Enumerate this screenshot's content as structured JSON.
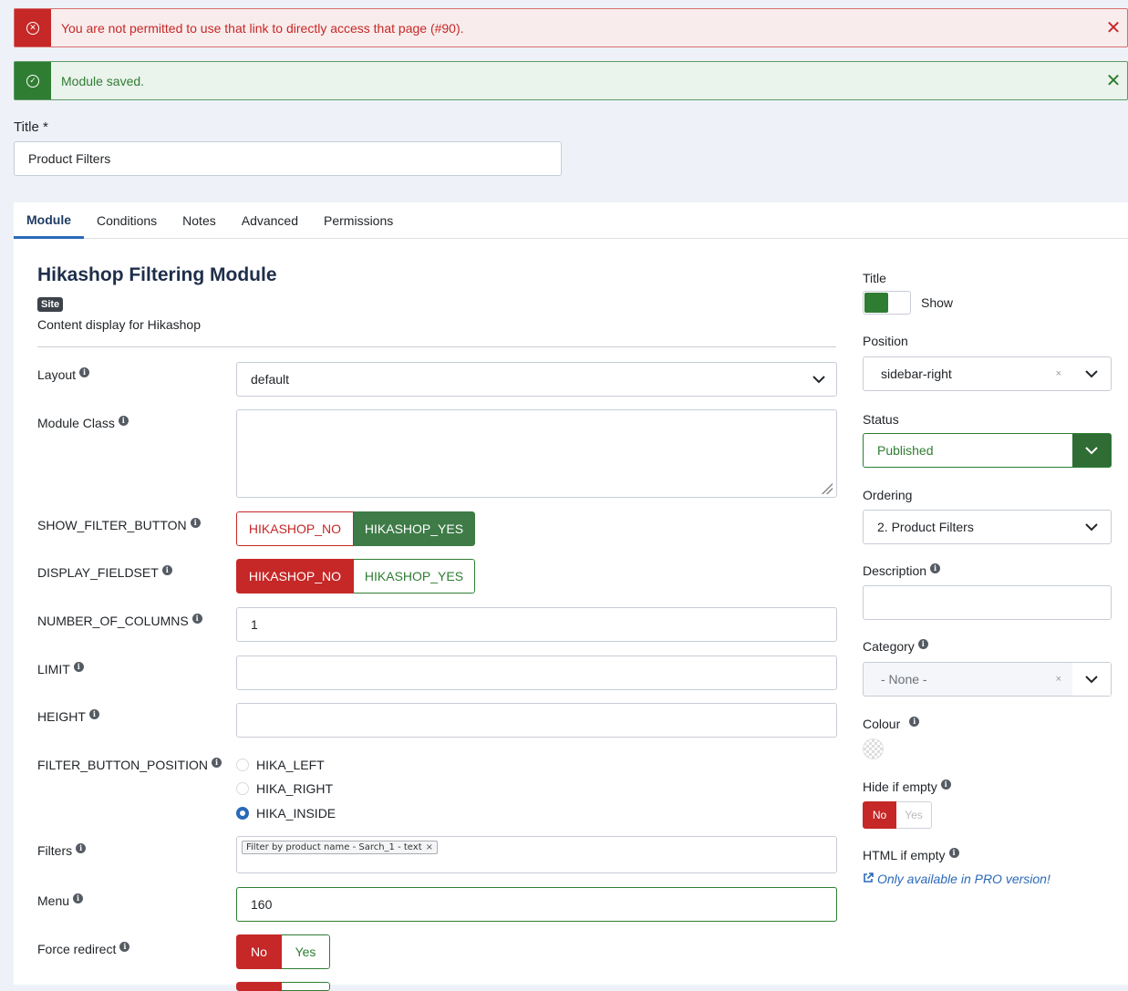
{
  "alerts": {
    "error": {
      "message": "You are not permitted to use that link to directly access that page (#90).",
      "icon": "x-circle-icon",
      "close": "✕"
    },
    "success": {
      "message": "Module saved.",
      "icon": "check-circle-icon",
      "close": "✕"
    }
  },
  "title_field": {
    "label": "Title *",
    "value": "Product Filters"
  },
  "tabs": [
    "Module",
    "Conditions",
    "Notes",
    "Advanced",
    "Permissions"
  ],
  "active_tab": "Module",
  "module": {
    "name": "Hikashop Filtering Module",
    "badge": "Site",
    "description": "Content display for Hikashop"
  },
  "form": {
    "layout": {
      "label": "Layout",
      "value": "default"
    },
    "module_class": {
      "label": "Module Class",
      "value": ""
    },
    "show_filter_button": {
      "label": "SHOW_FILTER_BUTTON",
      "no": "HIKASHOP_NO",
      "yes": "HIKASHOP_YES",
      "selected": "yes"
    },
    "display_fieldset": {
      "label": "DISPLAY_FIELDSET",
      "no": "HIKASHOP_NO",
      "yes": "HIKASHOP_YES",
      "selected": "no"
    },
    "number_of_columns": {
      "label": "NUMBER_OF_COLUMNS",
      "value": "1"
    },
    "limit": {
      "label": "LIMIT",
      "value": ""
    },
    "height": {
      "label": "HEIGHT",
      "value": ""
    },
    "filter_button_position": {
      "label": "FILTER_BUTTON_POSITION",
      "options": [
        "HIKA_LEFT",
        "HIKA_RIGHT",
        "HIKA_INSIDE"
      ],
      "selected": "HIKA_INSIDE"
    },
    "filters": {
      "label": "Filters",
      "chip": "Filter by product name - Sarch_1 - text",
      "chip_remove": "×"
    },
    "menu": {
      "label": "Menu",
      "value": "160"
    },
    "force_redirect": {
      "label": "Force redirect",
      "no": "No",
      "yes": "Yes",
      "selected": "no"
    }
  },
  "sidebar": {
    "title": {
      "label": "Title",
      "toggle_text": "Show",
      "enabled": true
    },
    "position": {
      "label": "Position",
      "value": "sidebar-right",
      "clear": "×"
    },
    "status": {
      "label": "Status",
      "value": "Published",
      "color": "#2f7d32"
    },
    "ordering": {
      "label": "Ordering",
      "value": "2. Product Filters"
    },
    "description": {
      "label": "Description",
      "value": ""
    },
    "category": {
      "label": "Category",
      "value": "- None -",
      "clear": "×"
    },
    "colour": {
      "label": "Colour"
    },
    "hide_if_empty": {
      "label": "Hide if empty",
      "no": "No",
      "yes": "Yes",
      "selected": "no"
    },
    "html_if_empty": {
      "label": "HTML if empty",
      "link": "Only available in PRO version!"
    }
  },
  "colors": {
    "error": "#c52827",
    "success": "#2f7d32",
    "accent": "#2a69b8"
  }
}
